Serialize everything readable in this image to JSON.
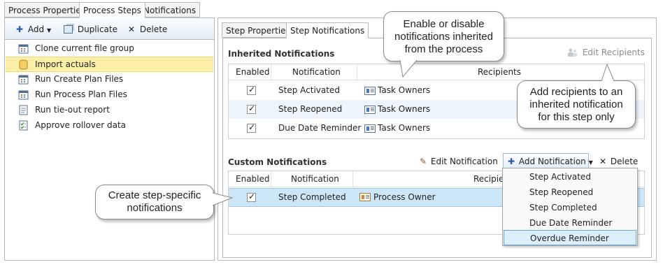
{
  "outer_tabs": [
    "Process Properties",
    "Process Steps",
    "Notifications"
  ],
  "left_toolbar": {
    "add": "Add",
    "duplicate": "Duplicate",
    "delete": "Delete"
  },
  "process_steps": [
    {
      "label": "Clone current file group",
      "icon": "calendar-icon"
    },
    {
      "label": "Import actuals",
      "icon": "database-icon",
      "selected": true
    },
    {
      "label": "Run Create Plan Files",
      "icon": "calendar-icon"
    },
    {
      "label": "Run Process Plan Files",
      "icon": "calendar-icon"
    },
    {
      "label": "Run tie-out report",
      "icon": "report-icon"
    },
    {
      "label": "Approve rollover data",
      "icon": "checklist-icon"
    }
  ],
  "inner_tabs": [
    "Step Properties",
    "Step Notifications"
  ],
  "inherited": {
    "title": "Inherited Notifications",
    "edit_recipients": "Edit Recipients",
    "columns": [
      "Enabled",
      "Notification",
      "Recipients"
    ],
    "rows": [
      {
        "enabled": true,
        "notification": "Step Activated",
        "recipients": "Task Owners"
      },
      {
        "enabled": true,
        "notification": "Step Reopened",
        "recipients": "Task Owners"
      },
      {
        "enabled": true,
        "notification": "Due Date Reminder",
        "recipients": "Task Owners"
      }
    ]
  },
  "custom": {
    "title": "Custom Notifications",
    "edit_notification": "Edit Notification",
    "add_notification": "Add Notification",
    "delete": "Delete",
    "columns": [
      "Enabled",
      "Notification",
      "Recipien"
    ],
    "rows": [
      {
        "enabled": true,
        "notification": "Step Completed",
        "recipients": "Process Owner"
      }
    ]
  },
  "dropdown_items": [
    "Step Activated",
    "Step Reopened",
    "Step Completed",
    "Due Date Reminder",
    "Overdue Reminder"
  ],
  "callouts": {
    "inherited": "Enable or disable\nnotifications inherited\nfrom the process",
    "recipients": "Add recipients to an\ninherited notification\nfor this step only",
    "custom": "Create step-specific\nnotifications"
  },
  "colors": {
    "selection": "#fbeea6",
    "row_highlight": "#cde6f7",
    "toolbar": "#e3ecf7"
  }
}
